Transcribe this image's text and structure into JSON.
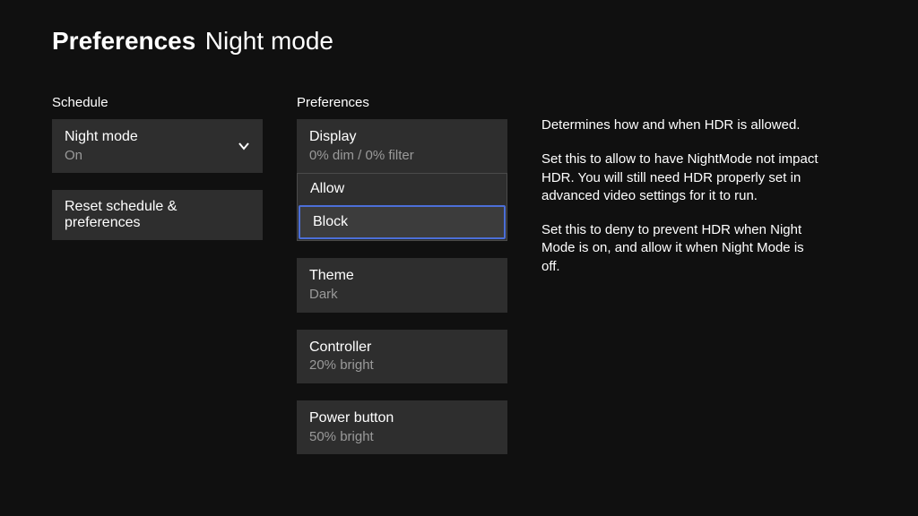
{
  "header": {
    "title": "Preferences",
    "subtitle": "Night mode"
  },
  "schedule": {
    "label": "Schedule",
    "nightmode": {
      "title": "Night mode",
      "value": "On"
    },
    "reset": "Reset schedule & preferences"
  },
  "prefs": {
    "label": "Preferences",
    "display": {
      "title": "Display",
      "value": "0% dim / 0% filter"
    },
    "hdr_options": {
      "allow": "Allow",
      "block": "Block"
    },
    "theme": {
      "title": "Theme",
      "value": "Dark"
    },
    "controller": {
      "title": "Controller",
      "value": "20% bright"
    },
    "power": {
      "title": "Power button",
      "value": "50% bright"
    }
  },
  "help": {
    "p1": "Determines how and when HDR is allowed.",
    "p2": "Set this to allow to have NightMode not impact HDR.  You will still need HDR properly set in advanced video settings for it to run.",
    "p3": "Set this to deny to prevent HDR when Night Mode is on, and allow it when Night Mode is off."
  }
}
